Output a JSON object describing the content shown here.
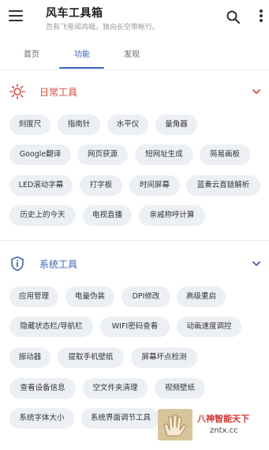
{
  "app": {
    "title": "风车工具箱",
    "subtitle": "忽有飞雪闻鸡唱，独向长空带帐行。"
  },
  "icons": {
    "menu": "hamburger-menu-icon",
    "search": "search-icon",
    "more": "more-vert-icon",
    "daily": "sun-icon",
    "system": "shield-info-icon",
    "chevron": "chevron-down-icon"
  },
  "tabs": [
    {
      "label": "首页"
    },
    {
      "label": "功能"
    },
    {
      "label": "发现"
    }
  ],
  "active_tab": "功能",
  "colors": {
    "accent": "#3a63b8",
    "daily_section": "#e0463e",
    "system_section": "#3a63b8",
    "chip_bg": "#eceff3"
  },
  "sections": [
    {
      "title": "日常工具",
      "chips": [
        "刻度尺",
        "指南针",
        "水平仪",
        "量角器",
        "Google翻译",
        "网页获源",
        "短网址生成",
        "简易画板",
        "LED滚动字幕",
        "打字板",
        "时间屏幕",
        "蓝奏云直链解析",
        "历史上的今天",
        "电视直播",
        "亲戚称呼计算"
      ]
    },
    {
      "title": "系统工具",
      "chips": [
        "应用管理",
        "电量伪装",
        "DPI修改",
        "高级重启",
        "隐藏状态栏/导航栏",
        "WIFI密码查看",
        "动画速度调控",
        "振动器",
        "提取手机壁纸",
        "屏幕坏点检测",
        "查看设备信息",
        "空文件夹清理",
        "视频壁纸",
        "系统字体大小",
        "系统界面调节工具"
      ]
    }
  ],
  "watermark": {
    "line1": "八神智能天下",
    "line2": "zntx.cc"
  }
}
